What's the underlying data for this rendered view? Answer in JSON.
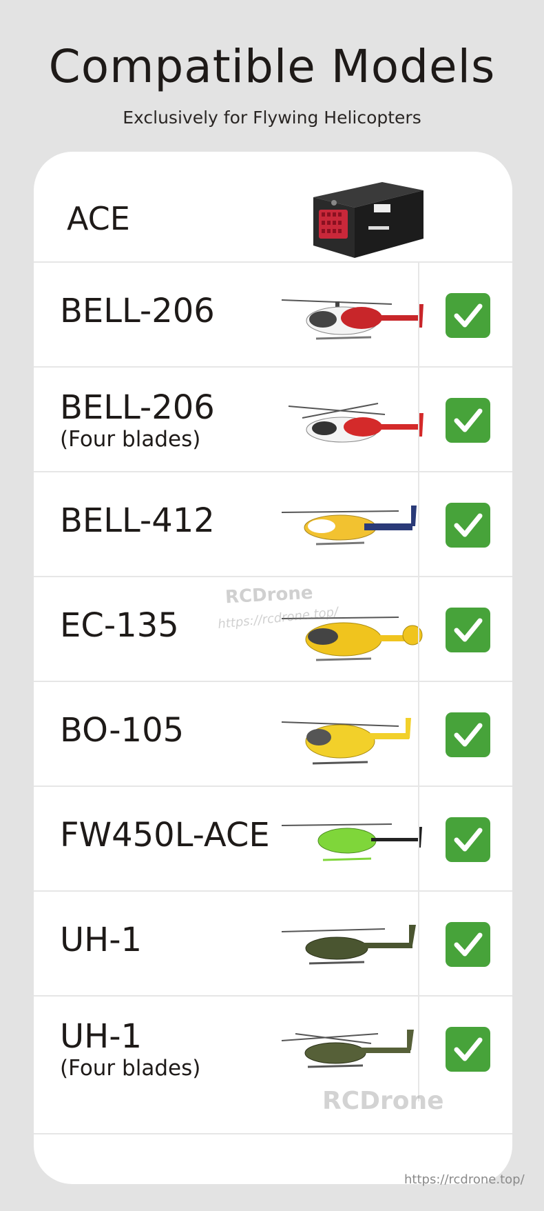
{
  "title": "Compatible Models",
  "subtitle": "Exclusively for Flywing Helicopters",
  "header": {
    "label": "ACE",
    "image": "ace-controller-box"
  },
  "rows": [
    {
      "name": "BELL-206",
      "sub": "",
      "image": "bell-206-helicopter",
      "colors": [
        "#ffffff",
        "#c8262a"
      ]
    },
    {
      "name": "BELL-206",
      "sub": "(Four blades)",
      "image": "bell-206-four-blade-helicopter",
      "colors": [
        "#ffffff",
        "#d42a2a"
      ]
    },
    {
      "name": "BELL-412",
      "sub": "",
      "image": "bell-412-helicopter",
      "colors": [
        "#f2c230",
        "#2a3a78"
      ]
    },
    {
      "name": "EC-135",
      "sub": "",
      "image": "ec-135-helicopter",
      "colors": [
        "#f0c41e",
        "#f0c41e"
      ]
    },
    {
      "name": "BO-105",
      "sub": "",
      "image": "bo-105-helicopter",
      "colors": [
        "#f2d02a",
        "#f2d02a"
      ]
    },
    {
      "name": "FW450L-ACE",
      "sub": "",
      "image": "fw450l-ace-helicopter",
      "colors": [
        "#7fd63a",
        "#222222"
      ]
    },
    {
      "name": "UH-1",
      "sub": "",
      "image": "uh-1-helicopter",
      "colors": [
        "#4a5530",
        "#4a5530"
      ]
    },
    {
      "name": "UH-1",
      "sub": "(Four blades)",
      "image": "uh-1-four-blade-helicopter",
      "colors": [
        "#566038",
        "#566038"
      ]
    }
  ],
  "check_color": "#47a33a",
  "watermarks": {
    "brand": "RCDrone",
    "url": "https://rcdrone.top/",
    "url_alt": "https://rcdrone.top/"
  },
  "footer_url": "https://rcdrone.top/"
}
